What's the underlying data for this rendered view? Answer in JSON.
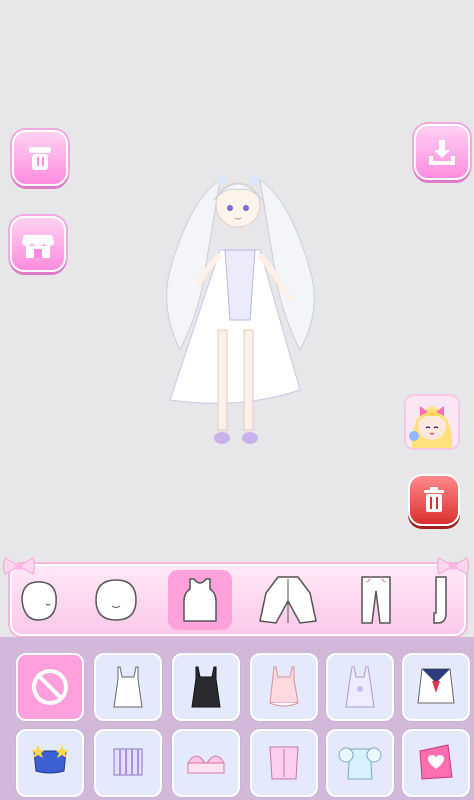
{
  "colors": {
    "background": "#e7e7e9",
    "accent_pink": "#ff8ddf",
    "selected_tab": "#ffa2dc",
    "delete_red": "#d9302f",
    "grid_bg": "#d3b9d9",
    "cell_bg": "#e4e9fb"
  },
  "left_buttons": [
    {
      "icon": "trash-bin-icon"
    },
    {
      "icon": "shop-icon"
    }
  ],
  "right_buttons": [
    {
      "icon": "download-icon"
    },
    {
      "icon": "character-avatar-icon"
    },
    {
      "icon": "delete-icon"
    }
  ],
  "categories": [
    {
      "name": "face-back",
      "icon": "head-side-icon"
    },
    {
      "name": "face",
      "icon": "head-icon"
    },
    {
      "name": "tops",
      "icon": "tank-top-icon",
      "selected": true
    },
    {
      "name": "outerwear",
      "icon": "cardigan-icon"
    },
    {
      "name": "pants",
      "icon": "pants-icon"
    },
    {
      "name": "socks",
      "icon": "sock-icon"
    }
  ],
  "items_row1": [
    "none",
    "white-camisole",
    "black-camisole",
    "pink-top",
    "lavender-lace-top",
    "sailor-top"
  ],
  "items_row2": [
    "blue-star-top",
    "purple-stripe-top",
    "shell-bra-top",
    "pink-corset-top",
    "blue-puff-top",
    "pink-heart-top"
  ]
}
